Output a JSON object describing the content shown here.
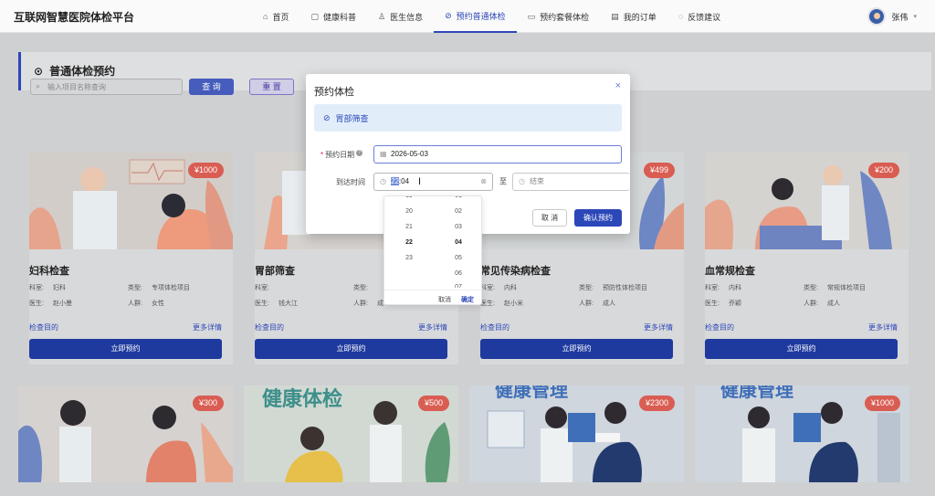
{
  "app": {
    "title": "互联网智慧医院体检平台"
  },
  "nav": {
    "items": [
      {
        "label": "首页",
        "icon": "home-icon",
        "glyph": "⌂"
      },
      {
        "label": "健康科普",
        "icon": "book-icon",
        "glyph": "▢"
      },
      {
        "label": "医生信息",
        "icon": "user-icon",
        "glyph": "♙"
      },
      {
        "label": "预约普通体检",
        "icon": "check-circle-icon",
        "glyph": "⊘",
        "active": true
      },
      {
        "label": "预约套餐体检",
        "icon": "cup-icon",
        "glyph": "▭"
      },
      {
        "label": "我的订单",
        "icon": "order-icon",
        "glyph": "▤"
      },
      {
        "label": "反馈建议",
        "icon": "comment-icon",
        "glyph": "◌"
      }
    ],
    "user": "张伟"
  },
  "page": {
    "title": "普通体检预约",
    "search_placeholder": "输入项目名称查询",
    "query_btn": "查 询",
    "reset_btn": "重 置"
  },
  "cards": [
    {
      "name": "妇科检查",
      "price": "¥1000",
      "dept_k": "科室:",
      "dept": "妇科",
      "type_k": "类型:",
      "type": "专项体检项目",
      "doc_k": "医生:",
      "doc": "赵小曼",
      "crowd_k": "人群:",
      "crowd": "女性",
      "goal": "检查目的",
      "more": "更多详情",
      "book": "立即预约"
    },
    {
      "name": "胃部筛查",
      "price": "",
      "dept_k": "科室:",
      "dept": "",
      "type_k": "类型:",
      "type": "",
      "doc_k": "医生:",
      "doc": "钱大江",
      "crowd_k": "人群:",
      "crowd": "成",
      "goal": "检查目的",
      "more": "更多详情",
      "book": "立即预约"
    },
    {
      "name": "常见传染病检查",
      "price": "¥499",
      "dept_k": "科室:",
      "dept": "内科",
      "type_k": "类型:",
      "type": "预防性体检项目",
      "doc_k": "医生:",
      "doc": "赵小米",
      "crowd_k": "人群:",
      "crowd": "成人",
      "goal": "检查目的",
      "more": "更多详情",
      "book": "立即预约"
    },
    {
      "name": "血常规检查",
      "price": "¥200",
      "dept_k": "科室:",
      "dept": "内科",
      "type_k": "类型:",
      "type": "常规体检项目",
      "doc_k": "医生:",
      "doc": "乔颖",
      "crowd_k": "人群:",
      "crowd": "成人",
      "goal": "检查目的",
      "more": "更多详情",
      "book": "立即预约"
    }
  ],
  "cards2": [
    {
      "price": "¥300"
    },
    {
      "price": "¥500",
      "banner_text": "健康体检"
    },
    {
      "price": "¥2300",
      "banner_text": "健康管理"
    },
    {
      "price": "¥1000",
      "banner_text": "健康管理"
    }
  ],
  "modal": {
    "title": "预约体检",
    "close": "×",
    "item": "胃部筛查",
    "date_label": "预约日期",
    "date_value": "2026-05-03",
    "time_label": "到达时间",
    "time_hour": "22",
    "time_rest": ":04",
    "to": "至",
    "end_placeholder": "结束",
    "cancel": "取 消",
    "confirm": "确认预约"
  },
  "picker": {
    "hours": [
      "19",
      "20",
      "21",
      "22",
      "23"
    ],
    "minutes": [
      "01",
      "02",
      "03",
      "04",
      "05",
      "06",
      "07"
    ],
    "selected_hour": "22",
    "selected_minute": "04",
    "cancel": "取消",
    "ok": "确定"
  }
}
